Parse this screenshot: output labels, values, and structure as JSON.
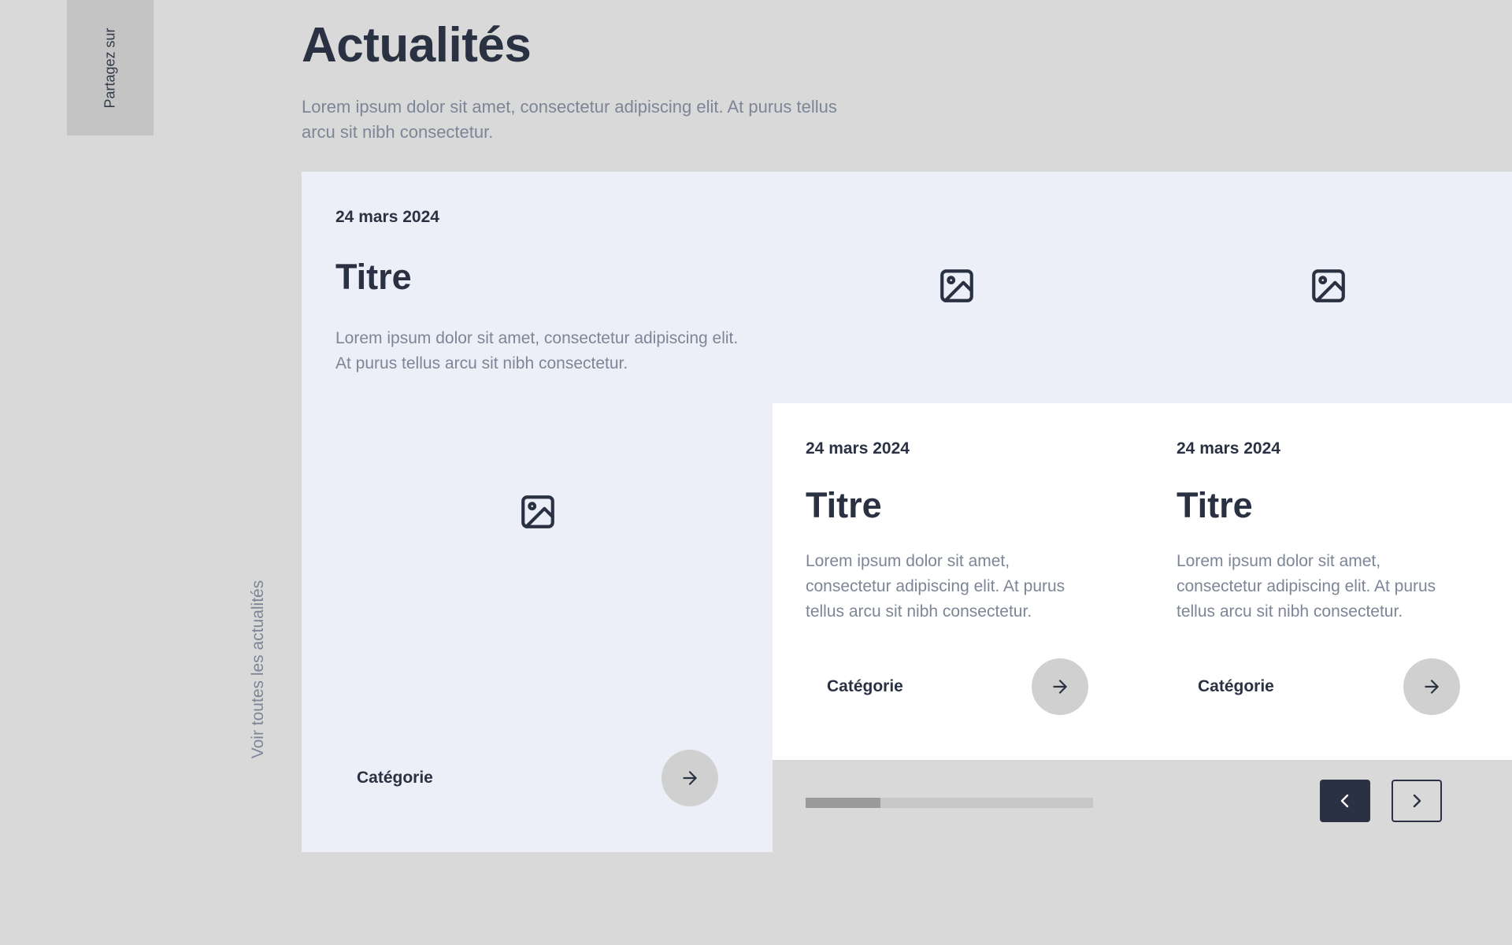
{
  "share": {
    "label": "Partagez sur"
  },
  "see_all": {
    "label": "Voir toutes les actualités"
  },
  "header": {
    "title": "Actualités",
    "intro": "Lorem ipsum dolor sit amet, consectetur adipiscing elit. At purus tellus arcu sit nibh consectetur."
  },
  "featured": {
    "date": "24 mars 2024",
    "title": "Titre",
    "description": "Lorem ipsum dolor sit amet, consectetur adipiscing elit. At purus tellus arcu sit nibh consectetur.",
    "category": "Catégorie",
    "image_icon": "image-icon",
    "arrow_icon": "arrow-right-icon"
  },
  "cards": [
    {
      "date": "24 mars 2024",
      "title": "Titre",
      "description": "Lorem ipsum dolor sit amet, consectetur adipiscing elit. At purus tellus arcu sit nibh consectetur.",
      "category": "Catégorie",
      "image_icon": "image-icon",
      "arrow_icon": "arrow-right-icon"
    },
    {
      "date": "24 mars 2024",
      "title": "Titre",
      "description": "Lorem ipsum dolor sit amet, consectetur adipiscing elit. At purus tellus arcu sit nibh consectetur.",
      "category": "Catégorie",
      "image_icon": "image-icon",
      "arrow_icon": "arrow-right-icon"
    }
  ],
  "carousel": {
    "progress": 0.26,
    "prev_icon": "chevron-left-icon",
    "next_icon": "chevron-right-icon"
  },
  "colors": {
    "page_bg": "#d9d9d9",
    "featured_bg": "#eceff8",
    "card_bg": "#ffffff",
    "text_dark": "#2a3142",
    "text_muted": "#7d8596",
    "button_bg": "#d0d0d0"
  }
}
